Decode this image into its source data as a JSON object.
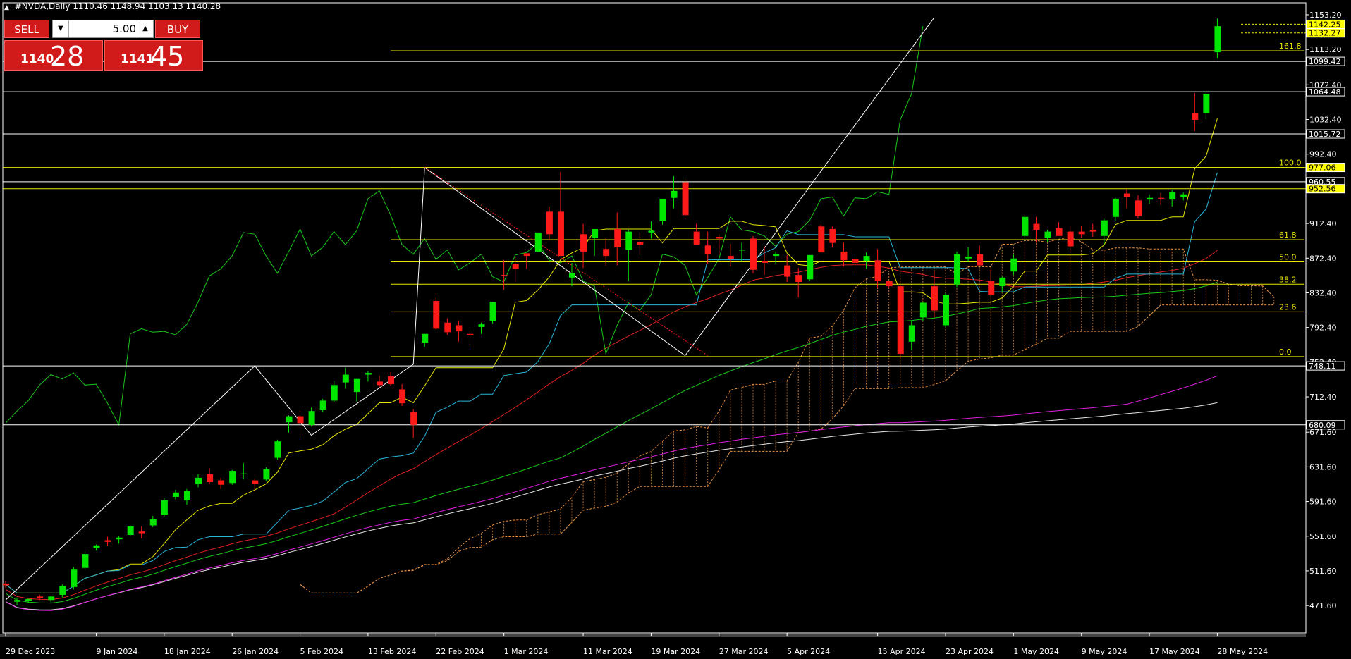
{
  "header": {
    "symbol": "#NVDA,Daily",
    "ohlc": "1110.46 1148.94 1103.13 1140.28"
  },
  "trade_panel": {
    "sell_label": "SELL",
    "buy_label": "BUY",
    "volume": "5.00",
    "bid_small": "1140",
    "bid_big": "28",
    "ask_small": "1141",
    "ask_big": "45",
    "color": "#d11a1a"
  },
  "chart_data": {
    "type": "candlestick",
    "ylim": [
      440,
      1167
    ],
    "price_axis_labels": [
      "1153.20",
      "1113.20",
      "1072.40",
      "1032.40",
      "992.40",
      "952.40",
      "912.40",
      "872.40",
      "832.40",
      "792.40",
      "752.40",
      "712.40",
      "671.60",
      "631.60",
      "591.60",
      "551.60",
      "511.60",
      "471.60"
    ],
    "date_labels": [
      "29 Dec 2023",
      "9 Jan 2024",
      "18 Jan 2024",
      "26 Jan 2024",
      "5 Feb 2024",
      "13 Feb 2024",
      "22 Feb 2024",
      "1 Mar 2024",
      "11 Mar 2024",
      "19 Mar 2024",
      "27 Mar 2024",
      "5 Apr 2024",
      "15 Apr 2024",
      "23 Apr 2024",
      "1 May 2024",
      "9 May 2024",
      "17 May 2024",
      "28 May 2024"
    ],
    "candles_per_label": [
      0,
      8,
      14,
      20,
      26,
      32,
      38,
      44,
      51,
      57,
      63,
      69,
      77,
      83,
      89,
      95,
      101,
      107
    ],
    "candles": [
      {
        "o": 497,
        "h": 500,
        "l": 492,
        "c": 495
      },
      {
        "o": 476,
        "h": 481,
        "l": 472,
        "c": 478
      },
      {
        "o": 477,
        "h": 480,
        "l": 475,
        "c": 479
      },
      {
        "o": 482,
        "h": 484,
        "l": 478,
        "c": 480
      },
      {
        "o": 478,
        "h": 483,
        "l": 474,
        "c": 482
      },
      {
        "o": 484,
        "h": 496,
        "l": 481,
        "c": 494
      },
      {
        "o": 493,
        "h": 516,
        "l": 490,
        "c": 513
      },
      {
        "o": 515,
        "h": 534,
        "l": 513,
        "c": 531
      },
      {
        "o": 538,
        "h": 542,
        "l": 535,
        "c": 541
      },
      {
        "o": 547,
        "h": 551,
        "l": 540,
        "c": 545
      },
      {
        "o": 548,
        "h": 552,
        "l": 543,
        "c": 550
      },
      {
        "o": 553,
        "h": 565,
        "l": 552,
        "c": 563
      },
      {
        "o": 557,
        "h": 563,
        "l": 549,
        "c": 555
      },
      {
        "o": 564,
        "h": 575,
        "l": 562,
        "c": 571
      },
      {
        "o": 576,
        "h": 596,
        "l": 574,
        "c": 593
      },
      {
        "o": 597,
        "h": 605,
        "l": 594,
        "c": 602
      },
      {
        "o": 593,
        "h": 606,
        "l": 588,
        "c": 604
      },
      {
        "o": 612,
        "h": 623,
        "l": 608,
        "c": 619
      },
      {
        "o": 623,
        "h": 630,
        "l": 612,
        "c": 614
      },
      {
        "o": 616,
        "h": 619,
        "l": 606,
        "c": 611
      },
      {
        "o": 613,
        "h": 628,
        "l": 611,
        "c": 627
      },
      {
        "o": 623,
        "h": 636,
        "l": 617,
        "c": 624
      },
      {
        "o": 616,
        "h": 618,
        "l": 604,
        "c": 612
      },
      {
        "o": 617,
        "h": 631,
        "l": 615,
        "c": 629
      },
      {
        "o": 642,
        "h": 663,
        "l": 640,
        "c": 661
      },
      {
        "o": 683,
        "h": 691,
        "l": 671,
        "c": 690
      },
      {
        "o": 690,
        "h": 696,
        "l": 665,
        "c": 682
      },
      {
        "o": 680,
        "h": 700,
        "l": 678,
        "c": 696
      },
      {
        "o": 697,
        "h": 710,
        "l": 695,
        "c": 708
      },
      {
        "o": 708,
        "h": 731,
        "l": 706,
        "c": 726
      },
      {
        "o": 729,
        "h": 746,
        "l": 722,
        "c": 738
      },
      {
        "o": 718,
        "h": 732,
        "l": 707,
        "c": 733
      },
      {
        "o": 738,
        "h": 742,
        "l": 730,
        "c": 740
      },
      {
        "o": 730,
        "h": 737,
        "l": 723,
        "c": 726
      },
      {
        "o": 736,
        "h": 741,
        "l": 725,
        "c": 727
      },
      {
        "o": 721,
        "h": 727,
        "l": 702,
        "c": 705
      },
      {
        "o": 695,
        "h": 698,
        "l": 665,
        "c": 680
      },
      {
        "o": 775,
        "h": 785,
        "l": 770,
        "c": 785
      },
      {
        "o": 823,
        "h": 827,
        "l": 790,
        "c": 791
      },
      {
        "o": 798,
        "h": 803,
        "l": 784,
        "c": 787
      },
      {
        "o": 795,
        "h": 800,
        "l": 776,
        "c": 788
      },
      {
        "o": 785,
        "h": 789,
        "l": 769,
        "c": 784
      },
      {
        "o": 793,
        "h": 798,
        "l": 785,
        "c": 796
      },
      {
        "o": 800,
        "h": 822,
        "l": 797,
        "c": 822
      },
      {
        "o": 853,
        "h": 870,
        "l": 836,
        "c": 852
      },
      {
        "o": 866,
        "h": 874,
        "l": 845,
        "c": 860
      },
      {
        "o": 878,
        "h": 878,
        "l": 860,
        "c": 875
      },
      {
        "o": 880,
        "h": 902,
        "l": 880,
        "c": 902
      },
      {
        "o": 926,
        "h": 932,
        "l": 893,
        "c": 900
      },
      {
        "o": 926,
        "h": 972,
        "l": 875,
        "c": 875
      },
      {
        "o": 850,
        "h": 867,
        "l": 840,
        "c": 855
      },
      {
        "o": 900,
        "h": 912,
        "l": 861,
        "c": 880
      },
      {
        "o": 896,
        "h": 905,
        "l": 875,
        "c": 906
      },
      {
        "o": 883,
        "h": 896,
        "l": 864,
        "c": 875
      },
      {
        "o": 906,
        "h": 925,
        "l": 864,
        "c": 885
      },
      {
        "o": 882,
        "h": 905,
        "l": 846,
        "c": 903
      },
      {
        "o": 891,
        "h": 903,
        "l": 876,
        "c": 888
      },
      {
        "o": 902,
        "h": 915,
        "l": 895,
        "c": 904
      },
      {
        "o": 915,
        "h": 940,
        "l": 911,
        "c": 941
      },
      {
        "o": 942,
        "h": 967,
        "l": 930,
        "c": 950
      },
      {
        "o": 960,
        "h": 964,
        "l": 917,
        "c": 922
      },
      {
        "o": 903,
        "h": 912,
        "l": 890,
        "c": 888
      },
      {
        "o": 887,
        "h": 903,
        "l": 866,
        "c": 877
      },
      {
        "o": 897,
        "h": 900,
        "l": 876,
        "c": 895
      },
      {
        "o": 875,
        "h": 889,
        "l": 863,
        "c": 871
      },
      {
        "o": 882,
        "h": 890,
        "l": 868,
        "c": 882
      },
      {
        "o": 895,
        "h": 898,
        "l": 855,
        "c": 859
      },
      {
        "o": 869,
        "h": 886,
        "l": 853,
        "c": 867
      },
      {
        "o": 875,
        "h": 880,
        "l": 865,
        "c": 877
      },
      {
        "o": 864,
        "h": 876,
        "l": 845,
        "c": 851
      },
      {
        "o": 853,
        "h": 861,
        "l": 827,
        "c": 845
      },
      {
        "o": 848,
        "h": 876,
        "l": 846,
        "c": 876
      },
      {
        "o": 909,
        "h": 911,
        "l": 880,
        "c": 879
      },
      {
        "o": 906,
        "h": 909,
        "l": 885,
        "c": 890
      },
      {
        "o": 880,
        "h": 890,
        "l": 863,
        "c": 870
      },
      {
        "o": 871,
        "h": 874,
        "l": 855,
        "c": 867
      },
      {
        "o": 869,
        "h": 879,
        "l": 860,
        "c": 875
      },
      {
        "o": 870,
        "h": 883,
        "l": 838,
        "c": 846
      },
      {
        "o": 846,
        "h": 846,
        "l": 838,
        "c": 840
      },
      {
        "o": 840,
        "h": 842,
        "l": 756,
        "c": 762
      },
      {
        "o": 776,
        "h": 800,
        "l": 766,
        "c": 795
      },
      {
        "o": 804,
        "h": 822,
        "l": 800,
        "c": 821
      },
      {
        "o": 840,
        "h": 858,
        "l": 804,
        "c": 812
      },
      {
        "o": 795,
        "h": 832,
        "l": 793,
        "c": 830
      },
      {
        "o": 842,
        "h": 880,
        "l": 839,
        "c": 877
      },
      {
        "o": 872,
        "h": 885,
        "l": 868,
        "c": 874
      },
      {
        "o": 877,
        "h": 887,
        "l": 870,
        "c": 864
      },
      {
        "o": 846,
        "h": 859,
        "l": 830,
        "c": 830
      },
      {
        "o": 840,
        "h": 851,
        "l": 833,
        "c": 850
      },
      {
        "o": 857,
        "h": 877,
        "l": 853,
        "c": 872
      },
      {
        "o": 898,
        "h": 922,
        "l": 891,
        "c": 920
      },
      {
        "o": 912,
        "h": 920,
        "l": 890,
        "c": 905
      },
      {
        "o": 896,
        "h": 905,
        "l": 891,
        "c": 903
      },
      {
        "o": 907,
        "h": 914,
        "l": 900,
        "c": 898
      },
      {
        "o": 903,
        "h": 910,
        "l": 880,
        "c": 886
      },
      {
        "o": 903,
        "h": 910,
        "l": 896,
        "c": 900
      },
      {
        "o": 905,
        "h": 912,
        "l": 897,
        "c": 903
      },
      {
        "o": 898,
        "h": 918,
        "l": 888,
        "c": 916
      },
      {
        "o": 920,
        "h": 942,
        "l": 915,
        "c": 941
      },
      {
        "o": 947,
        "h": 952,
        "l": 930,
        "c": 943
      },
      {
        "o": 939,
        "h": 945,
        "l": 918,
        "c": 921
      },
      {
        "o": 940,
        "h": 946,
        "l": 935,
        "c": 942
      },
      {
        "o": 942,
        "h": 948,
        "l": 934,
        "c": 941
      },
      {
        "o": 940,
        "h": 951,
        "l": 932,
        "c": 949
      },
      {
        "o": 943,
        "h": 948,
        "l": 939,
        "c": 946
      },
      {
        "o": 1040,
        "h": 1063,
        "l": 1019,
        "c": 1032
      },
      {
        "o": 1040,
        "h": 1065,
        "l": 1033,
        "c": 1062
      },
      {
        "o": 1110,
        "h": 1149,
        "l": 1103,
        "c": 1140
      }
    ],
    "horizontal_levels": [
      {
        "price": 1142.25,
        "label": "1142.25",
        "style": "tag-yellow"
      },
      {
        "price": 1132.27,
        "label": "1132.27",
        "style": "tag-yellow"
      },
      {
        "price": 1099.42,
        "label": "1099.42",
        "style": "tag-white"
      },
      {
        "price": 1064.48,
        "label": "1064.48",
        "style": "tag-white"
      },
      {
        "price": 1015.72,
        "label": "1015.72",
        "style": "tag-white"
      },
      {
        "price": 977.06,
        "label": "977.06",
        "style": "tag-yellow"
      },
      {
        "price": 960.55,
        "label": "960.55",
        "style": "tag-white"
      },
      {
        "price": 952.56,
        "label": "952.56",
        "style": "tag-yellow"
      },
      {
        "price": 748.11,
        "label": "748.11",
        "style": "tag-white"
      },
      {
        "price": 680.09,
        "label": "680.09",
        "style": "tag-white"
      }
    ],
    "fibonacci": [
      {
        "label": "161.8",
        "price": 1111.7
      },
      {
        "label": "100.0",
        "price": 977.0
      },
      {
        "label": "61.8",
        "price": 893.8
      },
      {
        "label": "50.0",
        "price": 868.1
      },
      {
        "label": "38.2",
        "price": 842.3
      },
      {
        "label": "23.6",
        "price": 810.5
      },
      {
        "label": "0.0",
        "price": 758.9
      }
    ],
    "colors": {
      "bull": "#00e600",
      "bear": "#ff1a1a",
      "grid": "#ffffff",
      "fib": "#e8e800",
      "tenkan": "#e8e800",
      "kijun": "#29b6d9",
      "chikou": "#19c819",
      "ma_red": "#e02020",
      "ma_green": "#19c819",
      "ma_magenta": "#e020e0",
      "ma_white": "#e6e6e6",
      "cloud": "#e89040"
    }
  }
}
